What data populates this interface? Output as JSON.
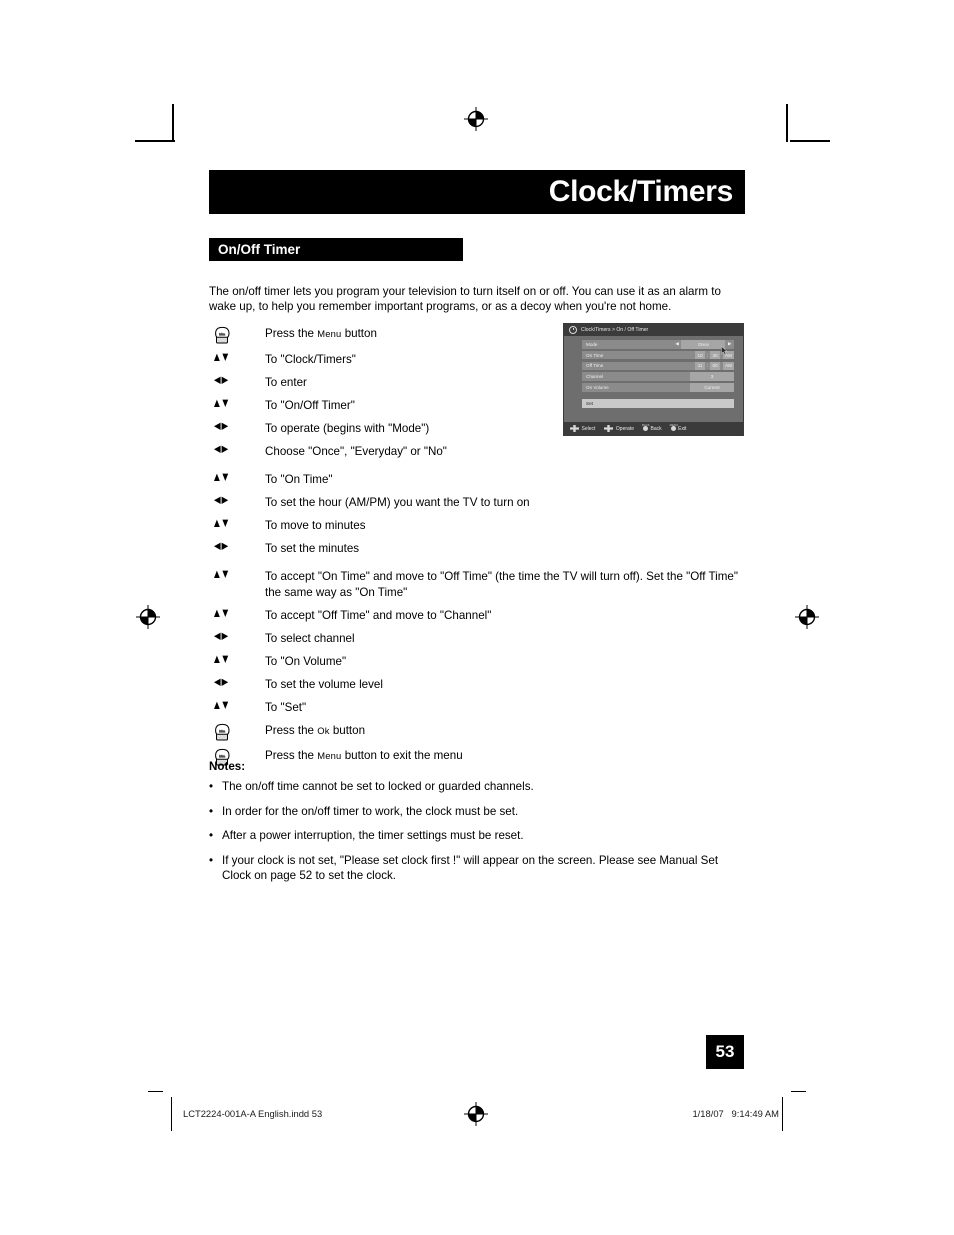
{
  "page": {
    "title": "Clock/Timers",
    "section": "On/Off Timer",
    "number": "53"
  },
  "intro": "The on/off timer lets you program your television to turn itself on or off. You can use it as an alarm to wake up, to help you remember important programs, or as a decoy when you're not home.",
  "steps": [
    {
      "icon": "hand-press-icon",
      "text_pre": "Press the ",
      "small_caps": "Menu",
      "text_post": " button"
    },
    {
      "icon": "up-down-arrow-icon",
      "text": "To \"Clock/Timers\""
    },
    {
      "icon": "left-right-arrow-icon",
      "text": "To enter"
    },
    {
      "icon": "up-down-arrow-icon",
      "text": "To \"On/Off Timer\""
    },
    {
      "icon": "left-right-arrow-icon",
      "text": "To operate (begins with \"Mode\")"
    },
    {
      "icon": "left-right-arrow-icon",
      "text": "Choose \"Once\", \"Everyday\" or \"No\""
    },
    {
      "icon": "up-down-arrow-icon",
      "text": "To \"On Time\""
    },
    {
      "icon": "left-right-arrow-icon",
      "text": "To set the hour (AM/PM) you want the TV to turn on"
    },
    {
      "icon": "up-down-arrow-icon",
      "text": "To move to minutes"
    },
    {
      "icon": "left-right-arrow-icon",
      "text": "To set the minutes"
    },
    {
      "icon": "up-down-arrow-icon",
      "text": "To accept \"On Time\" and move to \"Off Time\" (the time the TV will turn off). Set the \"Off Time\" the same way as \"On Time\""
    },
    {
      "icon": "up-down-arrow-icon",
      "text": "To accept \"Off Time\" and move to \"Channel\""
    },
    {
      "icon": "left-right-arrow-icon",
      "text": "To select channel"
    },
    {
      "icon": "up-down-arrow-icon",
      "text": "To \"On Volume\""
    },
    {
      "icon": "left-right-arrow-icon",
      "text": "To set the volume level"
    },
    {
      "icon": "up-down-arrow-icon",
      "text": "To \"Set\""
    },
    {
      "icon": "hand-press-icon",
      "text_pre": "Press the ",
      "small_caps": "Ok",
      "text_post": " button"
    },
    {
      "icon": "hand-press-icon",
      "text_pre": "Press the ",
      "small_caps": "Menu",
      "text_post": " button to exit the menu"
    }
  ],
  "osd": {
    "breadcrumb": "Clock/Timers > On / Off Timer",
    "rows": {
      "mode": {
        "label": "Mode",
        "value": "Once",
        "left_arrow": "◀",
        "right_arrow": "▶"
      },
      "on_time": {
        "label": "On Time",
        "hour": "10",
        "sep": ":",
        "minute": "30",
        "meridiem": "AM"
      },
      "off_time": {
        "label": "Off Time",
        "hour": "11",
        "sep": ":",
        "minute": "00",
        "meridiem": "AM"
      },
      "channel": {
        "label": "Channel",
        "value": "3"
      },
      "on_volume": {
        "label": "On Volume",
        "value": "Current"
      }
    },
    "set_button": "Set",
    "footer": [
      {
        "label": "Select",
        "icon": "dpad-icon"
      },
      {
        "label": "Operate",
        "icon": "dpad-icon"
      },
      {
        "label": "Back",
        "icon": "round-button-icon",
        "mini": "BACK"
      },
      {
        "label": "Exit",
        "icon": "round-button-icon",
        "mini": "MENU"
      }
    ]
  },
  "notes": {
    "heading": "Notes:",
    "items": [
      "The on/off time cannot be set to locked or guarded channels.",
      "In order for the on/off timer to work, the clock must be set.",
      "After a power interruption, the timer settings must be reset.",
      "If your clock is not set, \"Please set clock first !\" will appear on the screen.  Please see Manual Set Clock on page 52 to set the clock."
    ]
  },
  "footer": {
    "left": "LCT2224-001A-A English.indd   53",
    "right": "1/18/07   9:14:49 AM"
  }
}
